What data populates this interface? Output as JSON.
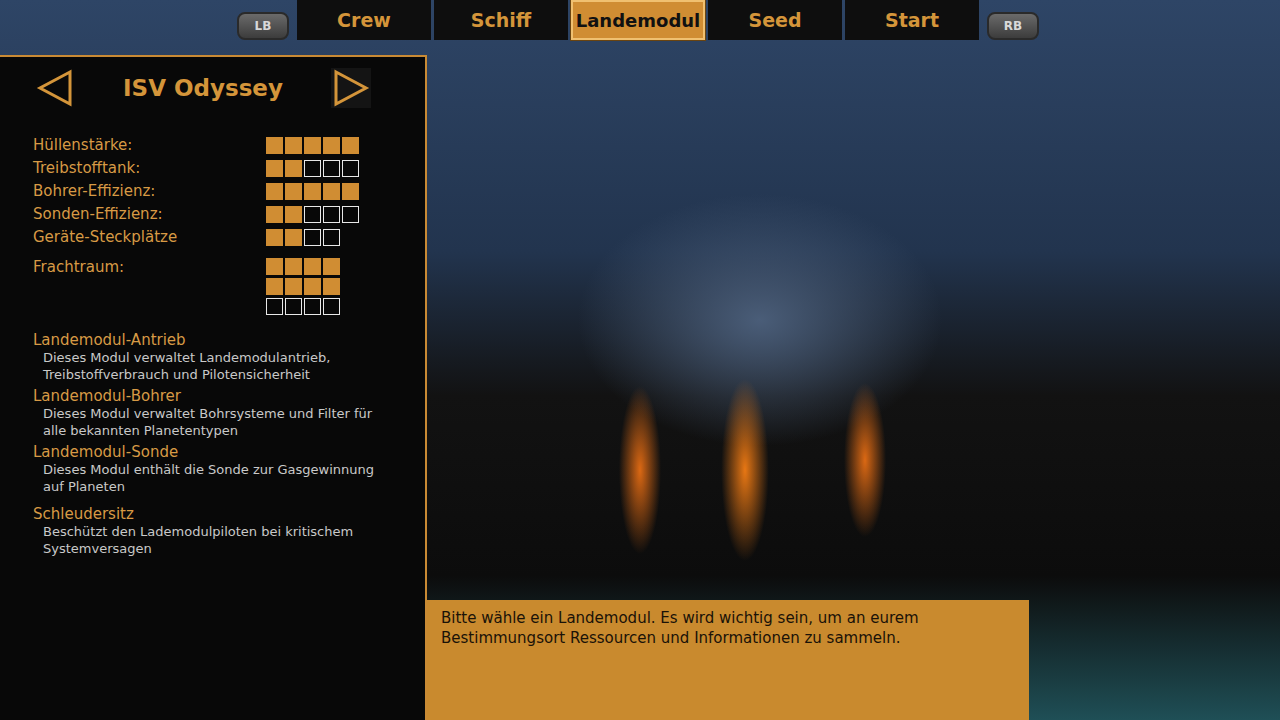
{
  "tabs": {
    "left_button": "LB",
    "right_button": "RB",
    "items": [
      {
        "label": "Crew",
        "selected": false
      },
      {
        "label": "Schiff",
        "selected": false
      },
      {
        "label": "Landemodul",
        "selected": true
      },
      {
        "label": "Seed",
        "selected": false
      },
      {
        "label": "Start",
        "selected": false
      }
    ]
  },
  "ship": {
    "name": "ISV Odyssey"
  },
  "stats": [
    {
      "label": "Hüllenstärke:",
      "stars": 5,
      "max": 5
    },
    {
      "label": "Treibstofftank:",
      "stars": 2,
      "max": 5
    },
    {
      "label": "Bohrer-Effizienz:",
      "stars": 5,
      "max": 5
    },
    {
      "label": "Sonden-Effizienz:",
      "stars": 2,
      "max": 5
    },
    {
      "label": "Geräte-Steckplätze",
      "stars": 2,
      "max": 4
    }
  ],
  "cargo": {
    "label": "Frachtraum:",
    "stars": 8,
    "max": 12
  },
  "modules": [
    {
      "title": "Landemodul-Antrieb",
      "description": "Dieses Modul verwaltet Landemodulantrieb, Treibstoffverbrauch und Pilotensicherheit"
    },
    {
      "title": "Landemodul-Bohrer",
      "description": "Dieses Modul verwaltet Bohrsysteme und Filter für alle bekannten Planetentypen"
    },
    {
      "title": "Landemodul-Sonde",
      "description": "Dieses Modul enthält die Sonde zur Gasgewinnung auf Planeten"
    },
    {
      "title": "Schleudersitz",
      "description": "Beschützt den Lademodulpiloten bei kritischem Systemversagen"
    }
  ],
  "message": "Bitte wähle ein Landemodul. Es wird wichtig sein, um an eurem Bestimmungsort Ressourcen und Informationen zu sammeln."
}
